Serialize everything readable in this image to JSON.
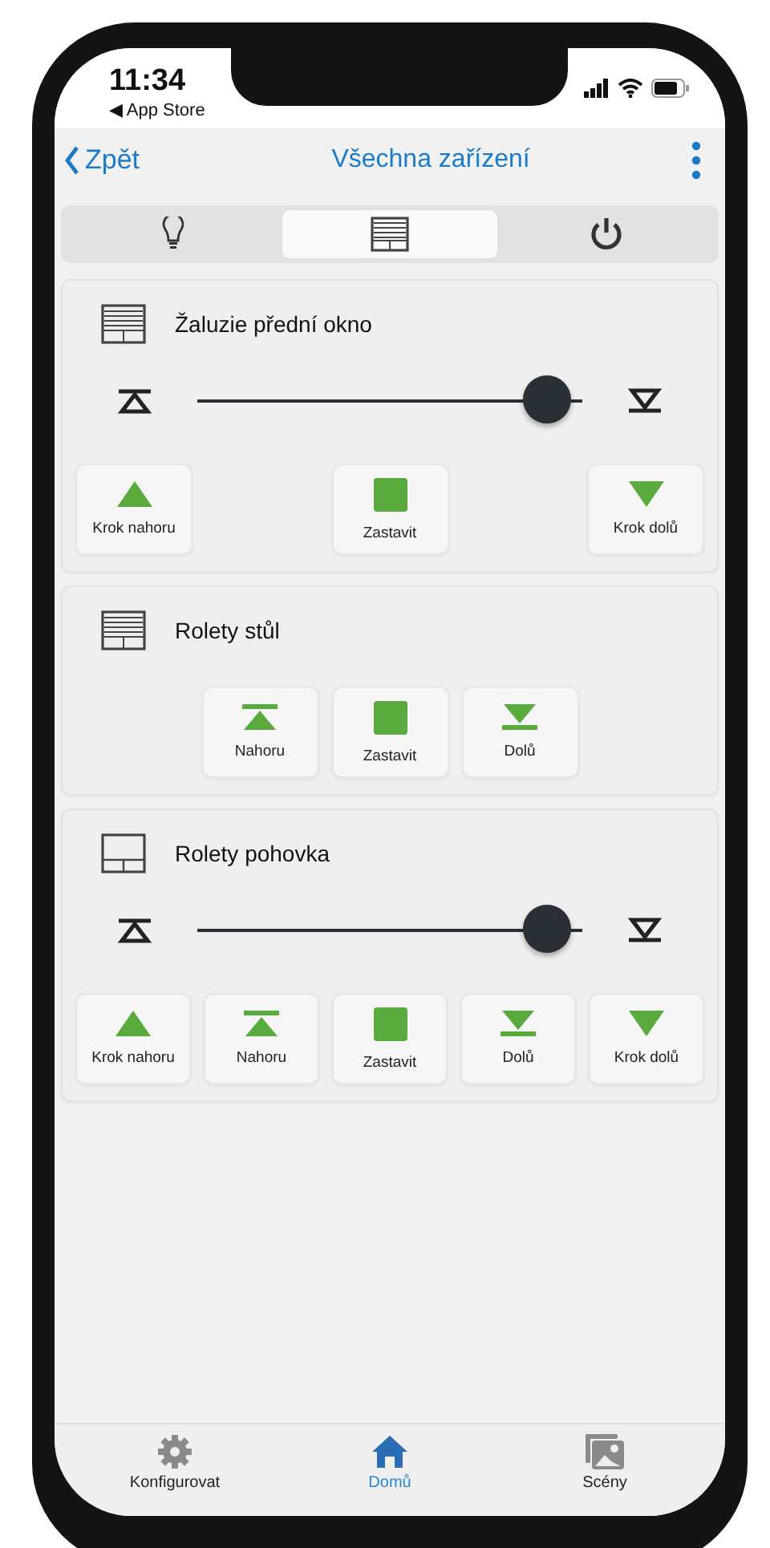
{
  "status_bar": {
    "time": "11:34",
    "back_app": "◀ App Store"
  },
  "nav": {
    "back": "Zpět",
    "title": "Všechna zařízení"
  },
  "tabs": [
    {
      "kind": "light",
      "selected": false
    },
    {
      "kind": "blind",
      "selected": true
    },
    {
      "kind": "power",
      "selected": false
    }
  ],
  "devices": [
    {
      "name": "Žaluzie přední okno",
      "kind": "blind",
      "slider": {
        "level": 0.92
      },
      "buttons": [
        {
          "kind": "step-up",
          "label": "Krok nahoru"
        },
        {
          "kind": "stop",
          "label": "Zastavit"
        },
        {
          "kind": "step-down",
          "label": "Krok dolů"
        }
      ]
    },
    {
      "name": "Rolety stůl",
      "kind": "blind",
      "buttons": [
        {
          "kind": "up",
          "label": "Nahoru"
        },
        {
          "kind": "stop",
          "label": "Zastavit"
        },
        {
          "kind": "down",
          "label": "Dolů"
        }
      ]
    },
    {
      "name": "Rolety pohovka",
      "kind": "window",
      "slider": {
        "level": 0.92
      },
      "buttons": [
        {
          "kind": "step-up",
          "label": "Krok nahoru"
        },
        {
          "kind": "up",
          "label": "Nahoru"
        },
        {
          "kind": "stop",
          "label": "Zastavit"
        },
        {
          "kind": "down",
          "label": "Dolů"
        },
        {
          "kind": "step-down",
          "label": "Krok dolů"
        }
      ]
    }
  ],
  "tab_bar": [
    {
      "kind": "gear",
      "label": "Konfigurovat",
      "selected": false
    },
    {
      "kind": "home",
      "label": "Domů",
      "selected": true
    },
    {
      "kind": "gallery",
      "label": "Scény",
      "selected": false
    }
  ]
}
